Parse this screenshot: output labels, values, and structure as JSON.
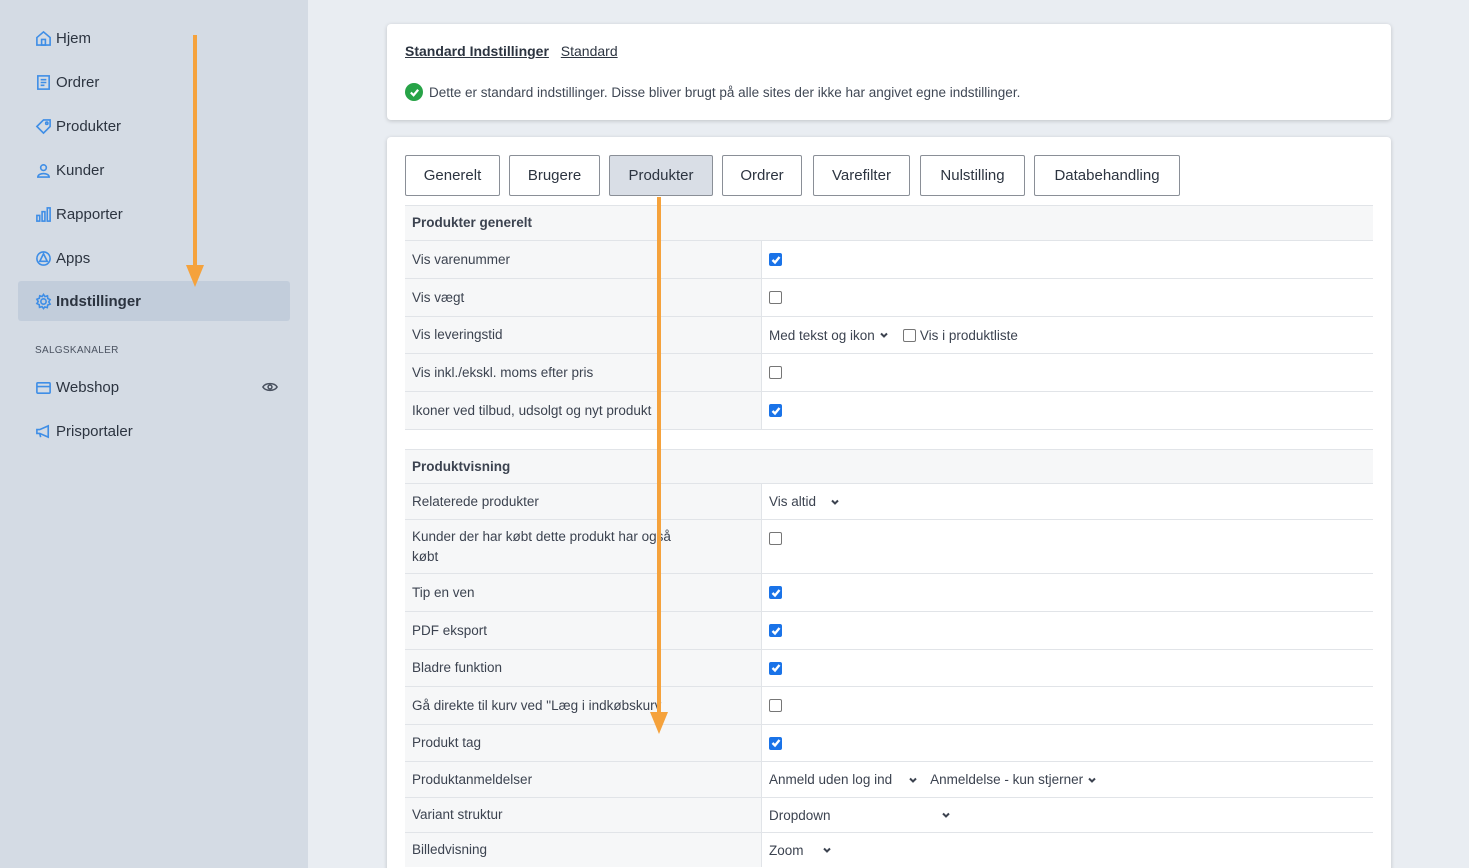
{
  "sidebar": {
    "items": [
      {
        "label": "Hjem",
        "icon": "home-icon"
      },
      {
        "label": "Ordrer",
        "icon": "orders-icon"
      },
      {
        "label": "Produkter",
        "icon": "tag-icon"
      },
      {
        "label": "Kunder",
        "icon": "user-icon"
      },
      {
        "label": "Rapporter",
        "icon": "chart-icon"
      },
      {
        "label": "Apps",
        "icon": "apps-icon"
      },
      {
        "label": "Indstillinger",
        "icon": "gear-icon",
        "active": true
      }
    ],
    "section_label": "SALGSKANALER",
    "channels": [
      {
        "label": "Webshop",
        "icon": "store-icon"
      },
      {
        "label": "Prisportaler",
        "icon": "megaphone-icon"
      }
    ]
  },
  "header": {
    "crumb_1": "Standard Indstillinger",
    "crumb_2": "Standard",
    "notice": "Dette er standard indstillinger. Disse bliver brugt på alle sites der ikke har angivet egne indstillinger."
  },
  "tabs": [
    "Generelt",
    "Brugere",
    "Produkter",
    "Ordrer",
    "Varefilter",
    "Nulstilling",
    "Databehandling"
  ],
  "active_tab": "Produkter",
  "sections": {
    "general_title": "Produkter generelt",
    "view_title": "Produktvisning"
  },
  "rows": {
    "vis_varenummer": {
      "label": "Vis varenummer",
      "checked": true
    },
    "vis_vaegt": {
      "label": "Vis vægt",
      "checked": false
    },
    "vis_leveringstid": {
      "label": "Vis leveringstid",
      "select": "Med tekst og ikon",
      "extra_label": "Vis i produktliste",
      "extra_checked": false
    },
    "vis_moms": {
      "label": "Vis inkl./ekskl. moms efter pris",
      "checked": false
    },
    "ikoner": {
      "label": "Ikoner ved tilbud, udsolgt og nyt produkt",
      "checked": true
    },
    "relaterede": {
      "label": "Relaterede produkter",
      "select": "Vis altid"
    },
    "kunder_koebt": {
      "label": "Kunder der har købt dette produkt har også købt",
      "checked": false
    },
    "tip": {
      "label": "Tip en ven",
      "checked": true
    },
    "pdf": {
      "label": "PDF eksport",
      "checked": true
    },
    "bladre": {
      "label": "Bladre funktion",
      "checked": true
    },
    "gaa_direkte": {
      "label": "Gå direkte til kurv ved \"Læg i indkøbskurv",
      "checked": false
    },
    "produkt_tag": {
      "label": "Produkt tag",
      "checked": true
    },
    "anmeldelser": {
      "label": "Produktanmeldelser",
      "select": "Anmeld uden log ind",
      "select_2": "Anmeldelse - kun stjerner"
    },
    "variant": {
      "label": "Variant struktur",
      "select": "Dropdown"
    },
    "billedvisning": {
      "label": "Billedvisning",
      "select": "Zoom"
    }
  },
  "colors": {
    "accent": "#1a73e8",
    "annotation_arrow": "#f5a23c",
    "success": "#27a347"
  }
}
